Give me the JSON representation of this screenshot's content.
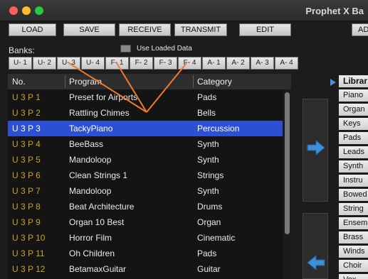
{
  "window": {
    "title": "Prophet X Ba"
  },
  "toolbar": {
    "load": "LOAD",
    "save": "SAVE",
    "receive": "RECEIVE",
    "transmit": "TRANSMIT",
    "edit": "EDIT",
    "ad": "AD"
  },
  "banks": {
    "label": "Banks:",
    "use_loaded_label": "Use Loaded Data",
    "tabs": [
      "U- 1",
      "U- 2",
      "U- 3",
      "U- 4",
      "F- 1",
      "F- 2",
      "F- 3",
      "F- 4",
      "A- 1",
      "A- 2",
      "A- 3",
      "A- 4"
    ]
  },
  "table": {
    "headers": {
      "no": "No.",
      "program": "Program",
      "category": "Category"
    },
    "rows": [
      {
        "no": "U 3 P 1",
        "program": "Preset for Airports",
        "category": "Pads"
      },
      {
        "no": "U 3 P 2",
        "program": "Rattling Chimes",
        "category": "Bells"
      },
      {
        "no": "U 3 P 3",
        "program": "TackyPiano",
        "category": "Percussion",
        "selected": true
      },
      {
        "no": "U 3 P 4",
        "program": "BeeBass",
        "category": "Synth"
      },
      {
        "no": "U 3 P 5",
        "program": "Mandoloop",
        "category": "Synth"
      },
      {
        "no": "U 3 P 6",
        "program": "Clean Strings 1",
        "category": "Strings"
      },
      {
        "no": "U 3 P 7",
        "program": "Mandoloop",
        "category": "Synth"
      },
      {
        "no": "U 3 P 8",
        "program": "Beat Architecture",
        "category": "Drums"
      },
      {
        "no": "U 3 P 9",
        "program": "Organ 10 Best",
        "category": "Organ"
      },
      {
        "no": "U 3 P 10",
        "program": "Horror Film",
        "category": "Cinematic"
      },
      {
        "no": "U 3 P 11",
        "program": "Oh Children",
        "category": "Pads"
      },
      {
        "no": "U 3 P 12",
        "program": "BetamaxGuitar",
        "category": "Guitar"
      }
    ]
  },
  "library": {
    "header": "Librar",
    "items": [
      "Piano",
      "Organ",
      "Keys",
      "Pads",
      "Leads",
      "Synth",
      "Instru",
      "Bowed",
      "String",
      "Ensem",
      "Brass",
      "Winds",
      "Choir",
      "Vox"
    ]
  },
  "colors": {
    "selection": "#2d4fd4",
    "number_text": "#c9a227",
    "arrow_blue": "#3d8fd6",
    "annotation": "#f07a2a"
  },
  "icons": {
    "transfer_right": "arrow-right-icon",
    "transfer_left": "arrow-left-icon",
    "library_marker": "triangle-right-icon"
  }
}
